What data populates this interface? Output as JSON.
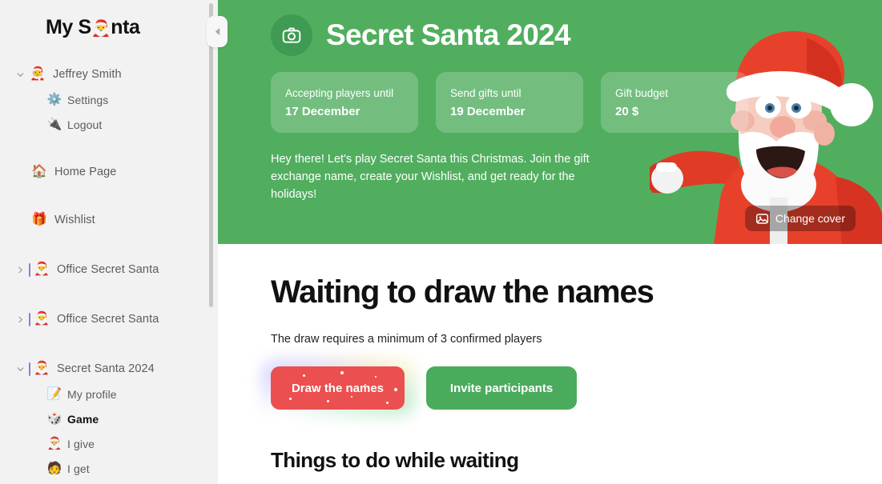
{
  "sidebar": {
    "brand_prefix": "My S",
    "brand_emoji": "🎅",
    "brand_suffix": "nta",
    "collapse_icon": "chevron-left-icon",
    "items": [
      {
        "label": "Jeffrey Smith",
        "emoji": "🧑‍🎄",
        "chevron": "expanded",
        "level": "top"
      },
      {
        "label": "Settings",
        "emoji": "⚙️",
        "chevron": "",
        "level": "child"
      },
      {
        "label": "Logout",
        "emoji": "🔌",
        "chevron": "",
        "level": "child"
      },
      {
        "label": "Home Page",
        "emoji": "🏠",
        "chevron": "",
        "level": "top"
      },
      {
        "label": "Wishlist",
        "emoji": "🎁",
        "chevron": "",
        "level": "top"
      },
      {
        "label": "Office Secret Santa",
        "emoji": "🎅",
        "chevron": "collapsed",
        "level": "group"
      },
      {
        "label": "Office Secret Santa",
        "emoji": "🎅",
        "chevron": "collapsed",
        "level": "group"
      },
      {
        "label": "Secret Santa 2024",
        "emoji": "🎅",
        "chevron": "expanded",
        "level": "group"
      },
      {
        "label": "My profile",
        "emoji": "📝",
        "chevron": "",
        "level": "child"
      },
      {
        "label": "Game",
        "emoji": "🎲",
        "chevron": "",
        "level": "child",
        "active": true
      },
      {
        "label": "I give",
        "emoji": "🎅",
        "chevron": "",
        "level": "child"
      },
      {
        "label": "I get",
        "emoji": "🧑",
        "chevron": "",
        "level": "child"
      }
    ]
  },
  "hero": {
    "camera_icon": "camera-icon",
    "title": "Secret Santa 2024",
    "cards": [
      {
        "label": "Accepting players until",
        "value": "17 December"
      },
      {
        "label": "Send gifts until",
        "value": "19 December"
      },
      {
        "label": "Gift budget",
        "value": "20 $"
      }
    ],
    "description": "Hey there! Let's play Secret Santa this Christmas. Join the gift exchange name, create your Wishlist, and get ready for the holidays!",
    "change_cover_label": "Change cover",
    "change_cover_icon": "image-icon",
    "bg_color": "#51ae5f",
    "card_color": "#6bbd76"
  },
  "main": {
    "heading": "Waiting to draw the names",
    "subtext": "The draw requires a minimum of 3 confirmed players",
    "draw_button_label": "Draw the names",
    "invite_button_label": "Invite participants",
    "draw_button_color": "#ec4f4f",
    "invite_button_color": "#4bab5d",
    "section_heading": "Things to do while waiting"
  }
}
